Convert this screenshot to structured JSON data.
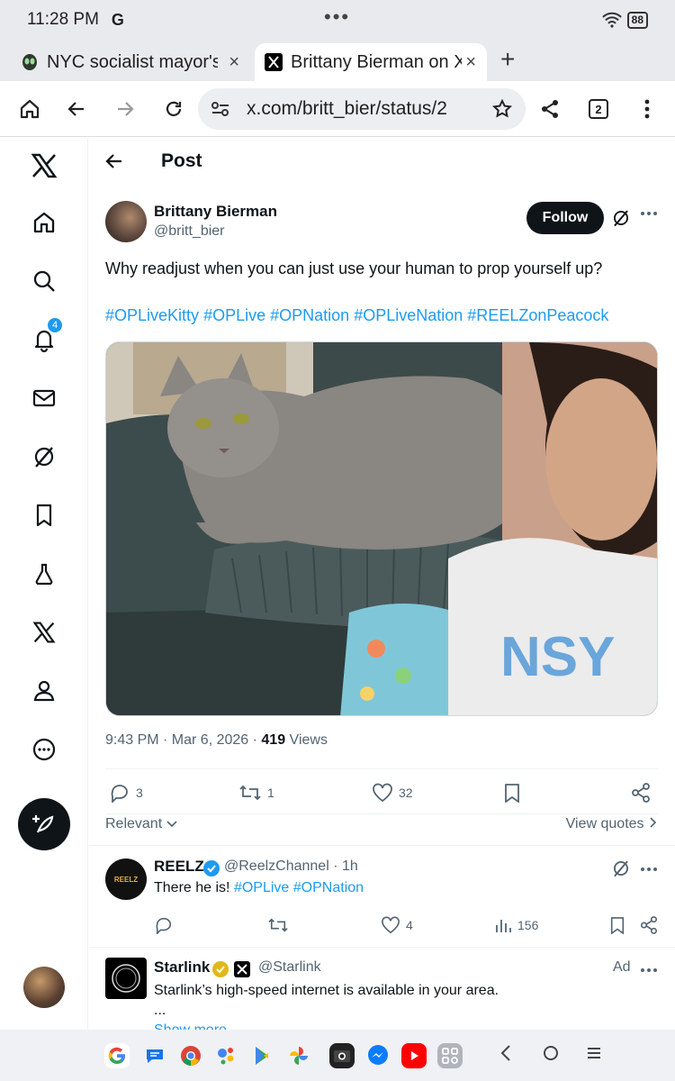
{
  "status_bar": {
    "time": "11:28 PM",
    "app_mark": "G",
    "dots": "•••",
    "battery": "88"
  },
  "browser": {
    "tabs": [
      {
        "label": "NYC socialist mayor's",
        "close": "×"
      },
      {
        "label": "Brittany Bierman on X",
        "close": "×"
      }
    ],
    "new_tab": "+",
    "url": "x.com/britt_bier/status/2",
    "tab_count": "2"
  },
  "nav": {
    "notifications_badge": "4"
  },
  "post_header": {
    "title": "Post"
  },
  "post": {
    "author_name": "Brittany Bierman",
    "author_handle": "@britt_bier",
    "follow_label": "Follow",
    "text": "Why readjust when you can just use your human to prop yourself up?",
    "hashtags": [
      "#OPLiveKitty",
      "#OPLive",
      "#OPNation",
      "#OPLiveNation",
      "#REELZonPeacock"
    ],
    "timestamp": "9:43 PM · Mar 6, 2026 · ",
    "views_count": "419",
    "views_label": " Views",
    "replies": "3",
    "reposts": "1",
    "likes": "32",
    "sort_label": "Relevant",
    "view_quotes": "View quotes"
  },
  "reply": {
    "avatar_text": "REELZ",
    "name": "REELZ",
    "handle": "@ReelzChannel · 1h",
    "text_plain": "There he is! ",
    "hashtags": "#OPLive #OPNation",
    "likes": "4",
    "views": "156"
  },
  "ad": {
    "name": "Starlink",
    "handle": "@Starlink",
    "ad_label": "Ad",
    "text": "Starlink’s high-speed internet is available in your area.",
    "ellipsis": "...",
    "show_more": "Show more"
  },
  "dock": {
    "apps": [
      {
        "label": "G",
        "color": "#ffffff"
      },
      {
        "label": "",
        "color": "#1a73e8"
      },
      {
        "label": "",
        "color": "#ffffff"
      },
      {
        "label": "",
        "color": "#ffffff"
      },
      {
        "label": "",
        "color": "#ffffff"
      },
      {
        "label": "",
        "color": "#ffffff"
      },
      {
        "label": "",
        "color": "#222222"
      },
      {
        "label": "",
        "color": "#0a7cff"
      },
      {
        "label": "",
        "color": "#ff0000"
      },
      {
        "label": "",
        "color": "#b0b4bc"
      }
    ]
  },
  "colors": {
    "accent": "#1d9bf0",
    "text": "#0f1419",
    "muted": "#536471"
  }
}
